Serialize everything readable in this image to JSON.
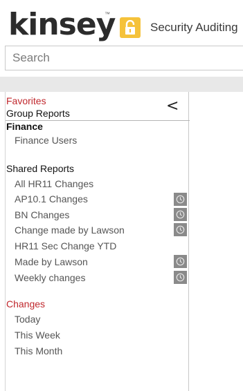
{
  "header": {
    "logo_text": "kinsey",
    "logo_tm": "™",
    "app_title": "Security Auditing",
    "brand_color": "#f5c23a"
  },
  "search": {
    "placeholder": "Search",
    "value": ""
  },
  "sidebar": {
    "collapse_label": "<",
    "favorites_label": "Favorites",
    "group_reports_label": "Group Reports",
    "finance": {
      "label": "Finance",
      "items": [
        "Finance Users"
      ]
    },
    "shared_reports": {
      "label": "Shared Reports",
      "items": [
        {
          "label": "All HR11 Changes",
          "scheduled": false
        },
        {
          "label": "AP10.1 Changes",
          "scheduled": true
        },
        {
          "label": "BN Changes",
          "scheduled": true
        },
        {
          "label": "Change made by Lawson",
          "scheduled": true
        },
        {
          "label": "HR11 Sec Change YTD",
          "scheduled": false
        },
        {
          "label": "Made by Lawson",
          "scheduled": true
        },
        {
          "label": "Weekly changes",
          "scheduled": true
        }
      ]
    },
    "changes": {
      "label": "Changes",
      "items": [
        "Today",
        "This Week",
        "This Month"
      ]
    }
  },
  "colors": {
    "section_red": "#c0282d",
    "schedule_badge": "#8a8a8a"
  }
}
